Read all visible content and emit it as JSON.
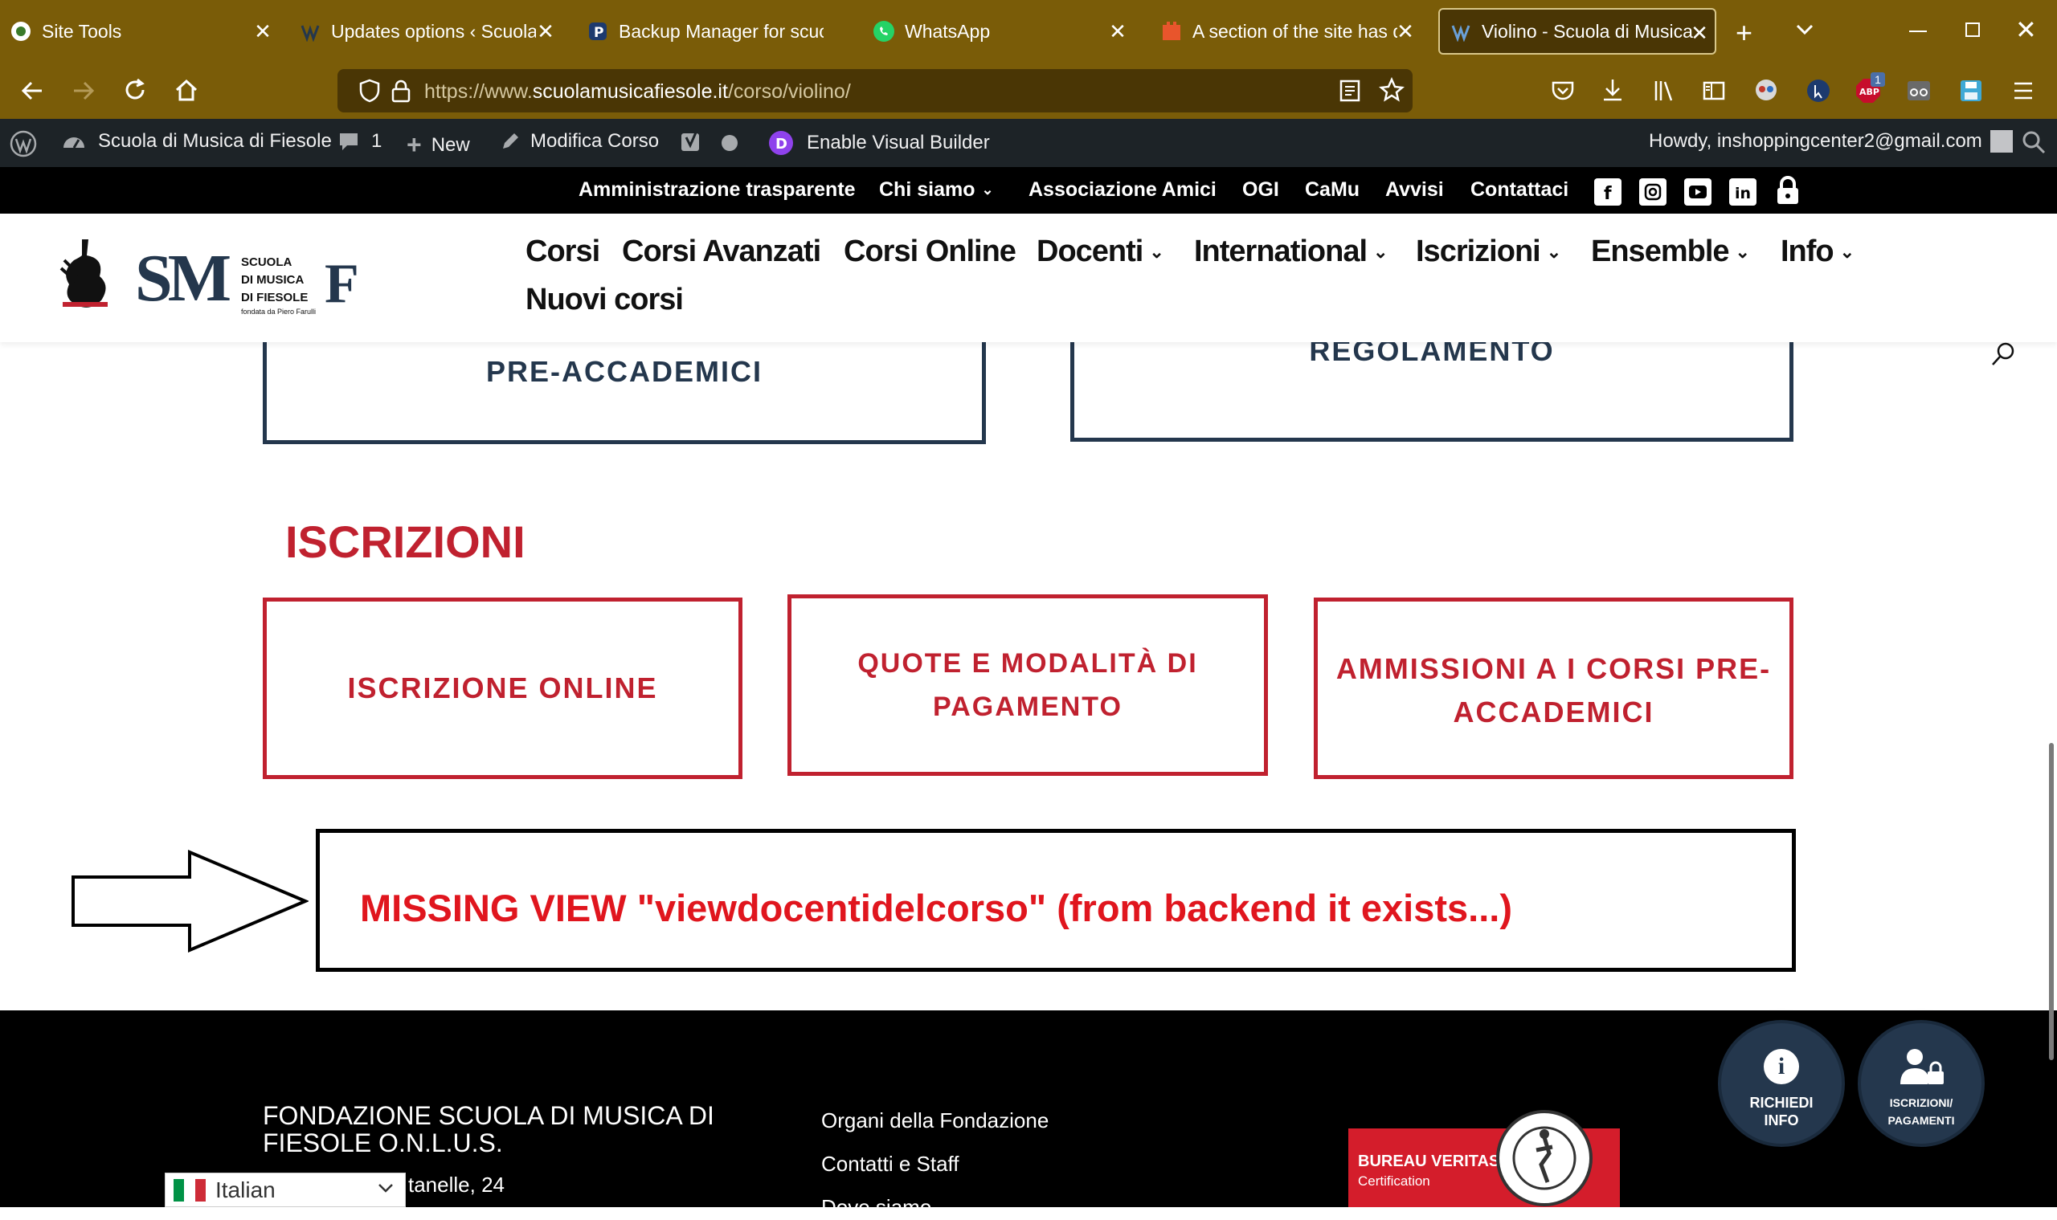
{
  "browser": {
    "tabs": [
      {
        "title": "Site Tools",
        "favicon": "sitetools-icon",
        "active": false
      },
      {
        "title": "Updates options ‹ Scuola di",
        "favicon": "wordpress-icon",
        "active": false
      },
      {
        "title": "Backup Manager for scuola",
        "favicon": "backup-manager-icon",
        "active": false
      },
      {
        "title": "WhatsApp",
        "favicon": "whatsapp-icon",
        "active": false
      },
      {
        "title": "A section of the site has dis",
        "favicon": "plugin-icon",
        "active": false
      },
      {
        "title": "Violino - Scuola di Musica d",
        "favicon": "site-favicon",
        "active": true
      }
    ],
    "url_prefix": "https://www.",
    "url_domain": "scuolamusicafiesole.it",
    "url_path": "/corso/violino/",
    "abp_badge": "1"
  },
  "wpbar": {
    "site_name": "Scuola di Musica di Fiesole",
    "comments_count": "1",
    "new_label": "New",
    "edit_label": "Modifica Corso",
    "visual_builder_label": "Enable Visual Builder",
    "howdy": "Howdy, inshoppingcenter2@gmail.com"
  },
  "topbar": {
    "links": [
      "Amministrazione trasparente",
      "Chi siamo",
      "Associazione Amici",
      "OGI",
      "CaMu",
      "Avvisi",
      "Contattaci"
    ]
  },
  "logo": {
    "line1": "SCUOLA",
    "line2": "DI MUSICA",
    "line3": "DI FIESOLE",
    "tagline": "fondata da Piero Farulli",
    "letters": "SM",
    "letter_f": "F"
  },
  "mainnav": {
    "items": [
      "Corsi",
      "Corsi Avanzati",
      "Corsi Online",
      "Docenti",
      "International",
      "Iscrizioni",
      "Ensemble",
      "Info",
      "Nuovi corsi"
    ]
  },
  "content": {
    "box_preaccademici": "PRE-ACCADEMICI",
    "box_regolamento": "REGOLAMENTO",
    "iscrizioni_heading": "ISCRIZIONI",
    "iscr_online": "ISCRIZIONE ONLINE",
    "quote_line1": "QUOTE E MODALITÀ DI",
    "quote_line2": "PAGAMENTO",
    "ammissioni_line1": "AMMISSIONI A I CORSI PRE-",
    "ammissioni_line2": "ACCADEMICI",
    "missing_view": "MISSING VIEW \"viewdocentidelcorso\"  (from backend it exists...)"
  },
  "footer": {
    "org_name_line1": "FONDAZIONE SCUOLA DI MUSICA DI",
    "org_name_line2": "FIESOLE O.N.L.U.S.",
    "address_partial": "tanelle, 24",
    "links": [
      "Organi della Fondazione",
      "Contatti e Staff",
      "Dove siamo"
    ],
    "cert_name": "BUREAU VERITAS",
    "cert_sub": "Certification",
    "seal_text": "BUREAU VERITAS"
  },
  "fabs": {
    "info_line1": "RICHIEDI",
    "info_line2": "INFO",
    "pay_line1": "ISCRIZIONI/",
    "pay_line2": "PAGAMENTI"
  },
  "language": {
    "selected": "Italian"
  },
  "colors": {
    "browser_chrome": "#7a5c08",
    "brand_red": "#c0212f",
    "brand_navy": "#24374d",
    "annotation_red": "#e0161e"
  }
}
